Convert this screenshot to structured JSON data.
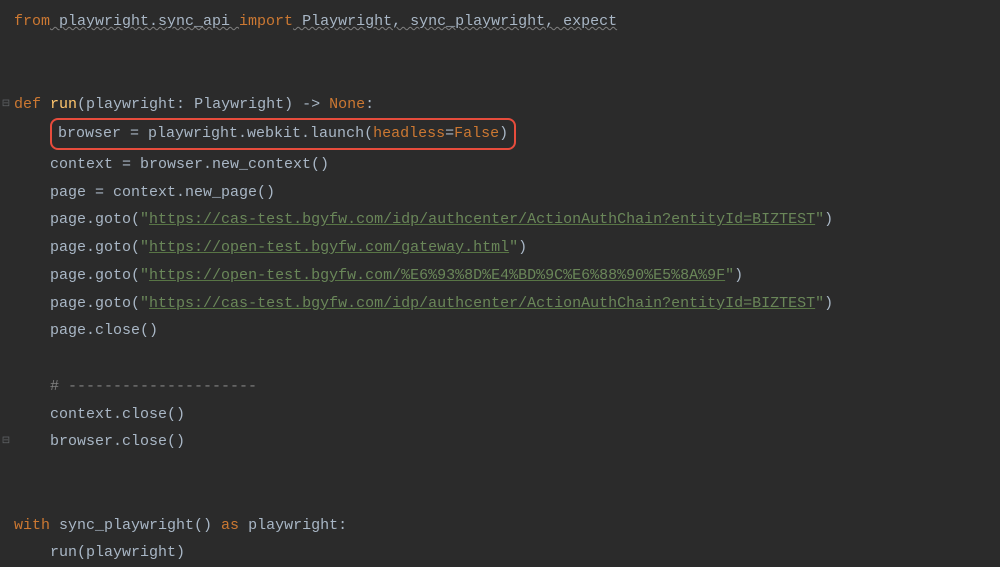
{
  "code": {
    "l1_from": "from",
    "l1_mod": " playwright.sync_api ",
    "l1_import": "import",
    "l1_names": " Playwright, sync_playwright, expect",
    "l2_def": "def ",
    "l2_name": "run",
    "l2_sig_open": "(",
    "l2_param": "playwright: Playwright",
    "l2_sig_close": ") -> ",
    "l2_none": "None",
    "l2_colon": ":",
    "l3_pre": "    ",
    "l3_browser": "browser = playwright.webkit.launch(",
    "l3_kwarg": "headless",
    "l3_eq": "=",
    "l3_val": "False",
    "l3_close": ")",
    "l4": "    context = browser.new_context()",
    "l5": "    page = context.new_page()",
    "l6_pre": "    page.goto(",
    "l6_q": "\"",
    "l6_url": "https://cas-test.bgyfw.com/idp/authcenter/ActionAuthChain?entityId=BIZTEST",
    "l7_url": "https://open-test.bgyfw.com/gateway.html",
    "l8_url": "https://open-test.bgyfw.com/%E6%93%8D%E4%BD%9C%E6%88%90%E5%8A%9F",
    "l9_url": "https://cas-test.bgyfw.com/idp/authcenter/ActionAuthChain?entityId=BIZTEST",
    "l6_post": ")",
    "l10": "    page.close()",
    "l11": "    # ---------------------",
    "l12": "    context.close()",
    "l13": "    browser.close()",
    "l14_with": "with ",
    "l14_call": "sync_playwright() ",
    "l14_as": "as ",
    "l14_var": "playwright:",
    "l15": "    run(playwright)"
  }
}
